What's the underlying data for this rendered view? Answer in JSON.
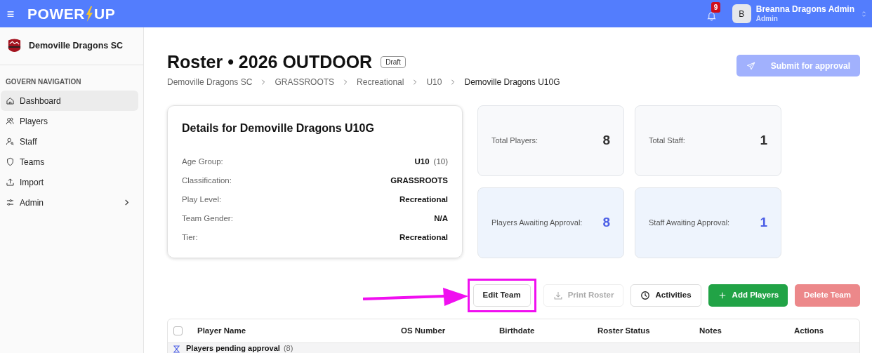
{
  "topbar": {
    "menu_icon": "≡",
    "logo": {
      "left": "POWER",
      "right": "UP"
    },
    "notifications": {
      "count": "9"
    },
    "user": {
      "initial": "B",
      "name": "Breanna Dragons Admin",
      "role": "Admin"
    }
  },
  "sidebar": {
    "org": "Demoville Dragons SC",
    "section": "GOVERN NAVIGATION",
    "items": [
      {
        "label": "Dashboard",
        "selected": true,
        "has_submenu": false
      },
      {
        "label": "Players",
        "selected": false,
        "has_submenu": false
      },
      {
        "label": "Staff",
        "selected": false,
        "has_submenu": false
      },
      {
        "label": "Teams",
        "selected": false,
        "has_submenu": false
      },
      {
        "label": "Import",
        "selected": false,
        "has_submenu": false
      },
      {
        "label": "Admin",
        "selected": false,
        "has_submenu": true
      }
    ]
  },
  "header": {
    "title": "Roster • 2026 OUTDOOR",
    "badge": "Draft",
    "submit": {
      "label": "Submit for approval",
      "disabled": true
    },
    "breadcrumbs": [
      {
        "label": "Demoville Dragons SC",
        "current": false
      },
      {
        "label": "GRASSROOTS",
        "current": false
      },
      {
        "label": "Recreational",
        "current": false
      },
      {
        "label": "U10",
        "current": false
      },
      {
        "label": "Demoville Dragons U10G",
        "current": true
      }
    ]
  },
  "details": {
    "title": "Details for Demoville Dragons U10G",
    "rows": [
      {
        "label": "Age Group:",
        "value": "U10",
        "note": "(10)"
      },
      {
        "label": "Classification:",
        "value": "GRASSROOTS"
      },
      {
        "label": "Play Level:",
        "value": "Recreational"
      },
      {
        "label": "Team Gender:",
        "value": "N/A"
      },
      {
        "label": "Tier:",
        "value": "Recreational"
      }
    ]
  },
  "stats": [
    {
      "label": "Total Players:",
      "value": "8",
      "highlight": false
    },
    {
      "label": "Total Staff:",
      "value": "1",
      "highlight": false
    },
    {
      "label": "Players Awaiting Approval:",
      "value": "8",
      "highlight": true
    },
    {
      "label": "Staff Awaiting Approval:",
      "value": "1",
      "highlight": true
    }
  ],
  "actions": [
    {
      "label": "Edit Team",
      "kind": "outline",
      "disabled": false,
      "annotated": true
    },
    {
      "label": "Print Roster",
      "kind": "outline",
      "disabled": true,
      "annotated": false
    },
    {
      "label": "Activities",
      "kind": "outline",
      "disabled": false,
      "annotated": false
    },
    {
      "label": "Add Players",
      "kind": "success",
      "disabled": false,
      "annotated": false
    },
    {
      "label": "Delete Team",
      "kind": "danger",
      "disabled": true,
      "annotated": false
    }
  ],
  "table": {
    "select_all": {
      "checked": false
    },
    "columns": [
      "Player Name",
      "OS Number",
      "Birthdate",
      "Roster Status",
      "Notes",
      "Actions"
    ],
    "groups": [
      {
        "label": "Players pending approval",
        "count": "(8)"
      }
    ]
  }
}
